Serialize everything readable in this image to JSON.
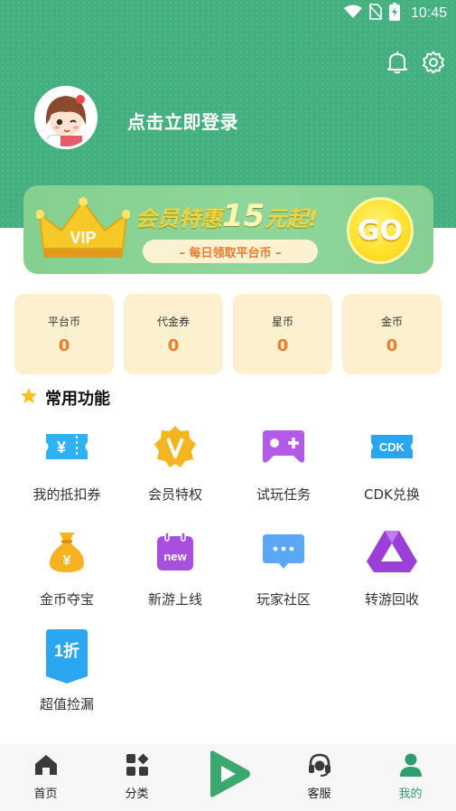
{
  "status_bar": {
    "time": "10:45"
  },
  "header": {
    "login_prompt": "点击立即登录"
  },
  "vip_banner": {
    "crown_text": "VIP",
    "headline_prefix": "会员特惠",
    "headline_number": "15",
    "headline_suffix": "元起!",
    "subline": "– 每日领取平台币 –",
    "button_label": "GO"
  },
  "wallet": [
    {
      "label": "平台币",
      "value": "0"
    },
    {
      "label": "代金券",
      "value": "0"
    },
    {
      "label": "星币",
      "value": "0"
    },
    {
      "label": "金币",
      "value": "0"
    }
  ],
  "features": {
    "title": "常用功能",
    "items": [
      {
        "label": "我的抵扣券",
        "icon": "coupon-icon",
        "color": "#2fb1f5"
      },
      {
        "label": "会员特权",
        "icon": "vip-badge-icon",
        "color": "#f5b51e"
      },
      {
        "label": "试玩任务",
        "icon": "gamepad-icon",
        "color": "#b35be8"
      },
      {
        "label": "CDK兑换",
        "icon": "cdk-icon",
        "color": "#29a6f2",
        "icon_text": "CDK"
      },
      {
        "label": "金币夺宝",
        "icon": "money-bag-icon",
        "color": "#f7b21f"
      },
      {
        "label": "新游上线",
        "icon": "new-calendar-icon",
        "color": "#a84fe0",
        "icon_text": "new"
      },
      {
        "label": "玩家社区",
        "icon": "chat-bubble-icon",
        "color": "#5aa8f5"
      },
      {
        "label": "转游回收",
        "icon": "triangle-recycle-icon",
        "color": "#9b3fd8"
      },
      {
        "label": "超值捡漏",
        "icon": "discount-tag-icon",
        "color": "#2aa7f0",
        "icon_text": "1折"
      }
    ]
  },
  "bottom_nav": [
    {
      "label": "首页",
      "icon": "home-icon"
    },
    {
      "label": "分类",
      "icon": "category-icon"
    },
    {
      "label": "",
      "icon": "play-icon"
    },
    {
      "label": "客服",
      "icon": "headset-icon"
    },
    {
      "label": "我的",
      "icon": "user-icon",
      "active": true
    }
  ],
  "colors": {
    "header_green": "#45b07f",
    "accent_green": "#2f9e6d",
    "value_orange": "#f07a2c",
    "wallet_bg": "#fdf0cf"
  }
}
